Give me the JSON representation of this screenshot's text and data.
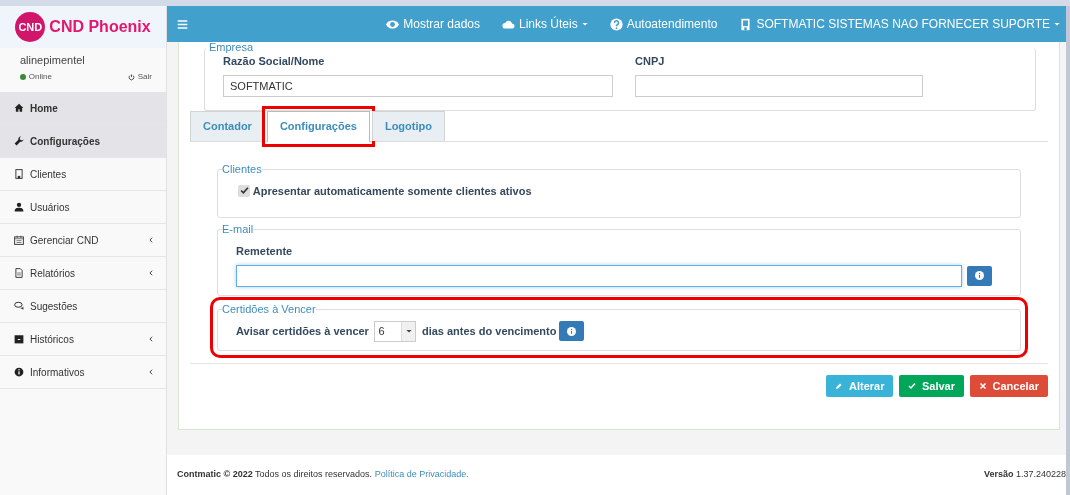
{
  "brand": {
    "logo_text": "CND",
    "name": "CND Phoenix"
  },
  "user": {
    "name": "alinepimentel",
    "status": "Online",
    "online": true,
    "logout": "Sair"
  },
  "sidebar": {
    "items": [
      {
        "label": "Home",
        "selected": true,
        "submenu": false
      },
      {
        "label": "Configurações",
        "selected": true,
        "submenu": false
      },
      {
        "label": "Clientes",
        "selected": false,
        "submenu": false
      },
      {
        "label": "Usuários",
        "selected": false,
        "submenu": false
      },
      {
        "label": "Gerenciar CND",
        "selected": false,
        "submenu": true
      },
      {
        "label": "Relatórios",
        "selected": false,
        "submenu": true
      },
      {
        "label": "Sugestões",
        "selected": false,
        "submenu": false
      },
      {
        "label": "Históricos",
        "selected": false,
        "submenu": true
      },
      {
        "label": "Informativos",
        "selected": false,
        "submenu": true
      }
    ]
  },
  "topbar": {
    "links": [
      {
        "label": "Mostrar dados",
        "dropdown": false
      },
      {
        "label": "Links Úteis",
        "dropdown": true
      },
      {
        "label": "Autoatendimento",
        "dropdown": false
      },
      {
        "label": "SOFTMATIC SISTEMAS NAO FORNECER SUPORTE",
        "dropdown": true
      }
    ]
  },
  "empresa": {
    "legend": "Empresa",
    "fields": [
      {
        "label": "Razão Social/Nome",
        "value": "SOFTMATIC"
      },
      {
        "label": "CNPJ"
      }
    ]
  },
  "tabs": [
    {
      "label": "Contador",
      "selected": false,
      "highlighted": false
    },
    {
      "label": "Configurações",
      "selected": true,
      "highlighted": true
    },
    {
      "label": "Logotipo",
      "selected": false,
      "highlighted": false
    }
  ],
  "clientes": {
    "legend": "Clientes",
    "checkbox": {
      "label": "Apresentar automaticamente somente clientes ativos",
      "checked": true
    }
  },
  "email": {
    "legend": "E-mail",
    "label": "Remetente",
    "focused": true
  },
  "certidoes": {
    "legend": "Certidões à Vencer",
    "text_before": "Avisar certidões à vencer",
    "days": "6",
    "text_after": "dias antes do vencimento",
    "highlighted": true
  },
  "buttons": [
    {
      "label": "Alterar",
      "kind": "edit"
    },
    {
      "label": "Salvar",
      "kind": "save"
    },
    {
      "label": "Cancelar",
      "kind": "cancel"
    }
  ],
  "footer": {
    "copyright": "**Contmatic © 2022** Todos os direitos reservados.",
    "privacy_link": "Política de Privacidade.",
    "version": "**Versão** 1.37.240228"
  }
}
